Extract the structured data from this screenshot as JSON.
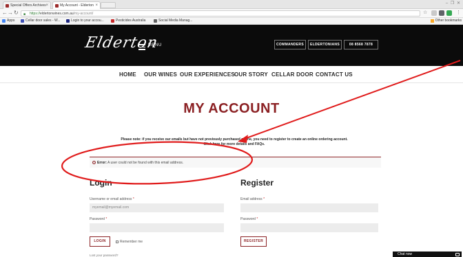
{
  "browser": {
    "tabs": [
      {
        "label": "Special Offers Archives"
      },
      {
        "label": "My Account - Elderton"
      }
    ],
    "window_controls": "– ❐ ✕",
    "url": {
      "secure": "https://",
      "host": "eldertonwines.com.au",
      "path": "/my-account/"
    },
    "bookmarks": [
      {
        "label": "Apps"
      },
      {
        "label": "Cellar door sales - W..."
      },
      {
        "label": "Login to your accou..."
      },
      {
        "label": "Pesticides Australia"
      },
      {
        "label": "Social Media Manag..."
      }
    ],
    "other_bookmarks": "Other bookmarks"
  },
  "site": {
    "logo_text": "Elderton",
    "menu_label": "MENU",
    "header_buttons": [
      "COMMANDERS",
      "ELDERTONIANS",
      "08 8568 7878"
    ],
    "nav": [
      "HOME",
      "OUR WINES",
      "OUR EXPERIENCES",
      "OUR STORY",
      "CELLAR DOOR",
      "CONTACT US"
    ]
  },
  "content": {
    "page_title": "MY ACCOUNT",
    "notice_line1": "Please note: if you receive our emails but have not previously purchased online, you need to register to create an online ordering account.",
    "notice_line2": "Click here for more details and FAQs.",
    "error_label": "Error:",
    "error_message": "A user could not be found with this email address.",
    "login": {
      "title": "Login",
      "username_label": "Username or email address",
      "username_value": "myemail@myemail.com",
      "password_label": "Password",
      "button": "LOGIN",
      "remember": "Remember me",
      "lost_password": "Lost your password?"
    },
    "register": {
      "title": "Register",
      "email_label": "Email address",
      "password_label": "Password",
      "button": "REGISTER"
    },
    "required_mark": "*"
  },
  "chat": {
    "label": "Chat now"
  },
  "colors": {
    "brand": "#8b2023",
    "header_bg": "#0b0b0b",
    "annotation": "#e01b1b"
  }
}
